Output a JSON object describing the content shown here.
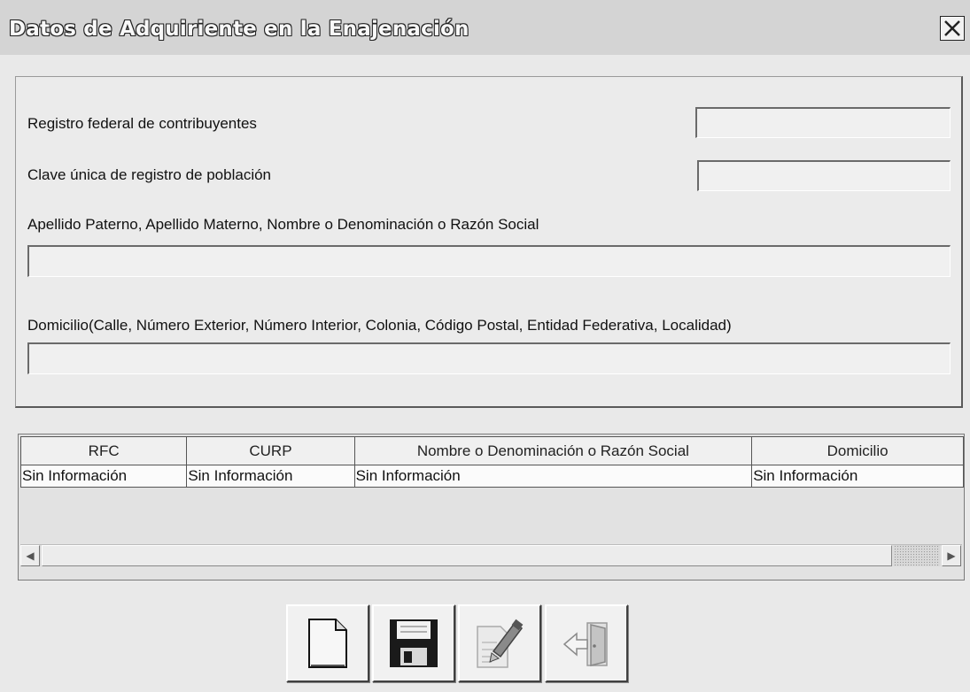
{
  "window": {
    "title": "Datos de Adquiriente en la Enajenación"
  },
  "form": {
    "rfc_label": "Registro federal de contribuyentes",
    "curp_label": "Clave única de registro de población",
    "name_label": "Apellido Paterno, Apellido Materno, Nombre o Denominación o Razón Social",
    "address_label": "Domicilio(Calle, Número Exterior, Número Interior, Colonia, Código Postal, Entidad Federativa, Localidad)",
    "rfc_value": "",
    "curp_value": "",
    "name_value": "",
    "address_value": ""
  },
  "grid": {
    "columns": [
      "RFC",
      "CURP",
      "Nombre o Denominación o Razón Social",
      "Domicilio"
    ],
    "rows": [
      [
        "Sin Información",
        "Sin Información",
        "Sin Información",
        "Sin Información"
      ]
    ]
  },
  "toolbar": {
    "buttons": [
      "new-document-icon",
      "save-floppy-icon",
      "edit-document-icon",
      "exit-door-icon"
    ]
  }
}
